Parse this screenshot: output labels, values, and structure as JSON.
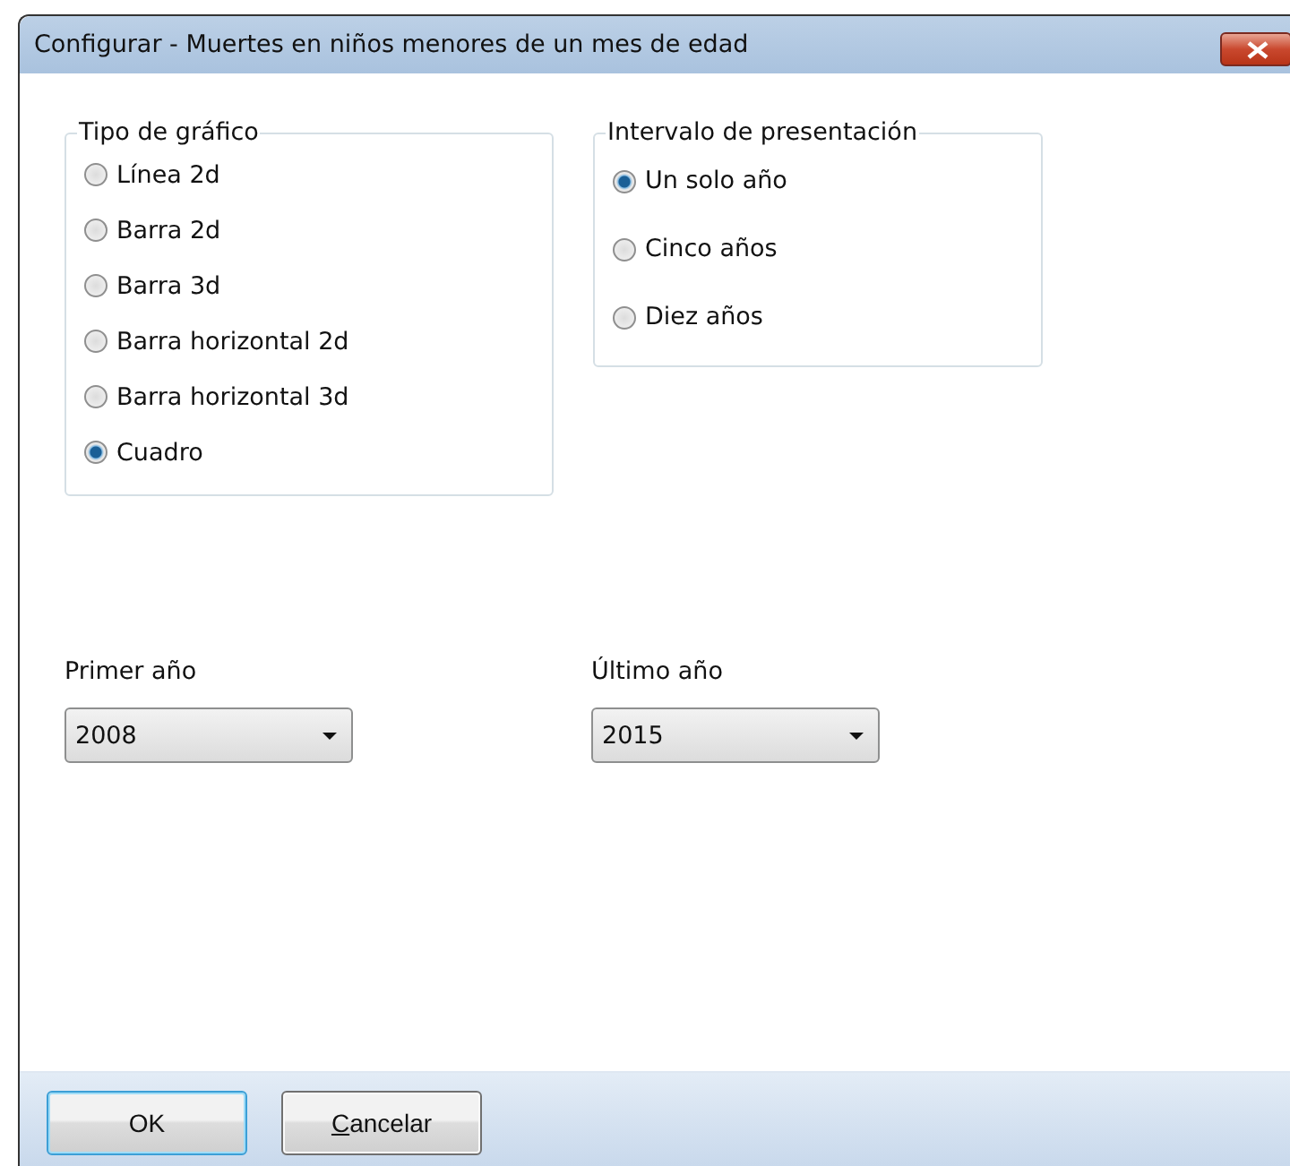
{
  "window": {
    "title": "Configurar - Muertes en niños menores de un mes de edad"
  },
  "groups": [
    {
      "legend": "Tipo de gráfico",
      "options": [
        {
          "label": "Línea 2d",
          "selected": false
        },
        {
          "label": "Barra 2d",
          "selected": false
        },
        {
          "label": "Barra 3d",
          "selected": false
        },
        {
          "label": "Barra horizontal 2d",
          "selected": false
        },
        {
          "label": "Barra horizontal 3d",
          "selected": false
        },
        {
          "label": "Cuadro",
          "selected": true
        }
      ]
    },
    {
      "legend": "Intervalo de presentación",
      "options": [
        {
          "label": "Un solo año",
          "selected": true
        },
        {
          "label": "Cinco años",
          "selected": false
        },
        {
          "label": "Diez años",
          "selected": false
        }
      ]
    }
  ],
  "selects": [
    {
      "label": "Primer año",
      "value": "2008"
    },
    {
      "label": "Último año",
      "value": "2015"
    }
  ],
  "buttons": [
    {
      "label": "OK",
      "default": true,
      "mnemonic": false
    },
    {
      "label": "Cancelar",
      "default": false,
      "mnemonic": true
    }
  ]
}
